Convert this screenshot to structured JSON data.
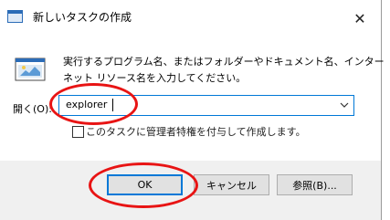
{
  "window": {
    "title": "新しいタスクの作成",
    "close_glyph": "✕"
  },
  "dialog": {
    "description_line1": "実行するプログラム名、またはフォルダーやドキュメント名、インター",
    "description_line2": "ネット リソース名を入力してください。",
    "open_label": "開く(O):",
    "open_value": "explorer",
    "admin_checkbox_label": "このタスクに管理者特権を付与して作成します。",
    "admin_checked": false
  },
  "buttons": {
    "ok": "OK",
    "cancel": "キャンセル",
    "browse": "参照(B)..."
  },
  "colors": {
    "accent": "#0078d7",
    "annotation": "#e81414",
    "footer": "#f0f0f0"
  },
  "icons": [
    "app-icon",
    "run-program-icon",
    "chevron-down-icon",
    "close-icon"
  ]
}
